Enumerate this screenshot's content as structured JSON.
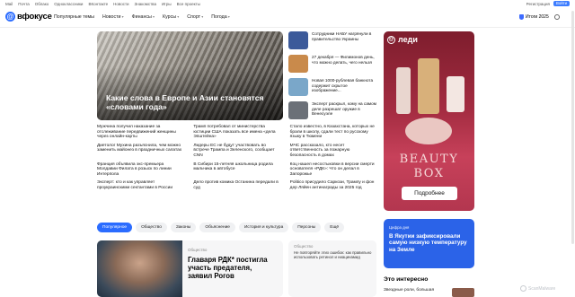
{
  "topbar": {
    "links": [
      "Mail",
      "Почта",
      "Облако",
      "Одноклассники",
      "ВКонтакте",
      "Новости",
      "Знакомства",
      "Игры",
      "Все проекты"
    ],
    "register": "Регистрация",
    "login": "Войти"
  },
  "header": {
    "logo": "вфокусе",
    "nav": [
      {
        "label": "Популярные темы",
        "caret": false
      },
      {
        "label": "Новости",
        "caret": true
      },
      {
        "label": "Финансы",
        "caret": true
      },
      {
        "label": "Курсы",
        "caret": true
      },
      {
        "label": "Спорт",
        "caret": true
      },
      {
        "label": "Погода",
        "caret": true
      }
    ],
    "year_badge": "Итоги 2025"
  },
  "hero": {
    "title": "Какие слова в Европе и Азии становятся «словами года»"
  },
  "side_news": [
    {
      "text": "Сотрудники НАБУ нагрянули в правительство Украины",
      "color": "#3c5a9a"
    },
    {
      "text": "27 декабря — Филимонов день, что можно делать, чего нельзя",
      "color": "#c98a4b"
    },
    {
      "text": "Новая 1000-рублевая банкнота содержит скрытое изображение...",
      "color": "#7aa7c9"
    },
    {
      "text": "Эксперт раскрыл, кому на самом деле разрешат оружие в Венесуэле",
      "color": "#6b7078"
    }
  ],
  "news_grid": [
    [
      "Мужчина получил наказание за отслеживание передвижений женщины через онлайн-карты",
      "Трамп потребовал от министерства юстиции США показать все имена «дела Эпштейна»",
      "Стало известно, в Казахстана, которых не брали в школу, сдали тест по русскому языку в Тюмени"
    ],
    [
      "Диетолог Мухина разъяснила, чем можно заменить майонез в праздничных салатах",
      "Лидеры ЕС не будут участвовать во встрече Трампа и Зеленского, сообщает CNN",
      "МЧС рассказало, кто несет ответственность за пожарную безопасность в домах"
    ],
    [
      "Франция объявила экс-премьера Молдавии Филата в розыск по линии Интерпола",
      "В Сибири 15-летняя школьница родила мальчика в автобусе",
      "Коц нашел несостыковки в версии смерти основателя «РДК»: Что он делал в Запорожье"
    ],
    [
      "Эксперт: кто и как управляет проукраинскими сектантами в России",
      "Дело против комика Останина передали в суд",
      "Politico присудило Саркози, Трампу и фон дер Ляйен антинаграды за 2025 год"
    ]
  ],
  "tags": [
    "Популярное",
    "Общество",
    "Законы",
    "Объяснение",
    "История и культура",
    "Персоны",
    "Ещё"
  ],
  "main_card": {
    "category": "Общество",
    "headline": "Главаря РДК* постигла участь предателя, заявил Рогов"
  },
  "second_card": {
    "category": "Общество",
    "text": "Не повторяйте этих ошибок: как правильно использовать ретинол и ниацинамид"
  },
  "ad": {
    "brand": "леди",
    "line1": "BEAUTY",
    "line2": "BOX",
    "cta": "Подробнее"
  },
  "promo": {
    "small": "Цифра дня",
    "big": "В Якутии зафиксировали самую низкую температуру на Земле"
  },
  "interesting": {
    "title": "Это интересно",
    "item": "Звездные роли, большая"
  },
  "watermark": "ScanMalware"
}
